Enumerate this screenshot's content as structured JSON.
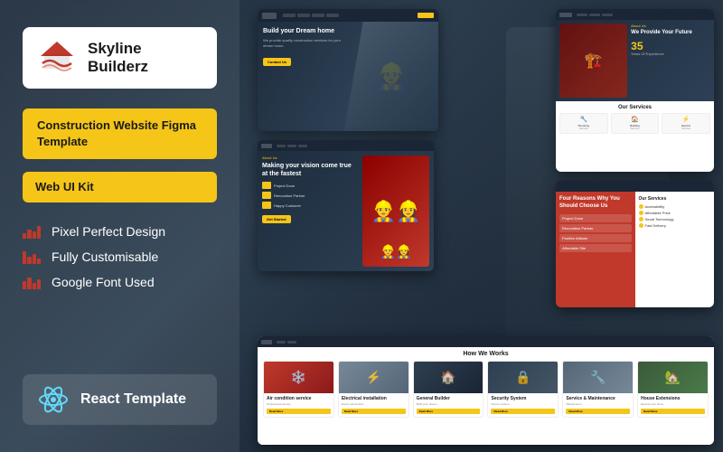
{
  "brand": {
    "name": "Skyline Builderz",
    "tagline": ""
  },
  "badges": {
    "figma": "Construction Website Figma Template",
    "webui": "Web UI Kit",
    "react": "React Template"
  },
  "features": [
    {
      "id": "pixel-perfect",
      "label": "Pixel Perfect Design"
    },
    {
      "id": "customisable",
      "label": "Fully Customisable"
    },
    {
      "id": "google-font",
      "label": "Google Font Used"
    }
  ],
  "mockup1": {
    "hero_title": "Build your Dream home",
    "hero_sub": "We provide quality construction services for your dream home.",
    "cta": "Contact Us"
  },
  "mockup2": {
    "about_tag": "About Us",
    "about_title": "We Provide Your Future",
    "stat_number": "35",
    "stat_label": "Years Of Experience",
    "section_title": "Our Services"
  },
  "mockup3": {
    "section_tag": "About Us",
    "section_title": "Making your vision come true at the fastest",
    "features": [
      "Project Done",
      "Renovation Partner",
      "Happy Customer"
    ],
    "cta": "Get Started"
  },
  "mockup4": {
    "left_title": "Four Reasons Why You Should Choose Us",
    "reasons": [
      "Project Done",
      "Renovation Partner",
      "Positive Attitude",
      "Affordable Site"
    ],
    "right_title": "Our Services",
    "services": [
      "Accessibility",
      "Affordable Price",
      "Smart Technology",
      "Fast Delivery"
    ]
  },
  "mockup5": {
    "title": "How We Works",
    "cards": [
      {
        "title": "Air condition service",
        "sub": "Read More"
      },
      {
        "title": "Electrical installation",
        "sub": "Read More"
      },
      {
        "title": "General Builder",
        "sub": "Read More"
      },
      {
        "title": "Security System",
        "sub": "Read More"
      },
      {
        "title": "Service & Maintenance",
        "sub": "Read More"
      },
      {
        "title": "House Extensions",
        "sub": "Read More"
      }
    ]
  }
}
